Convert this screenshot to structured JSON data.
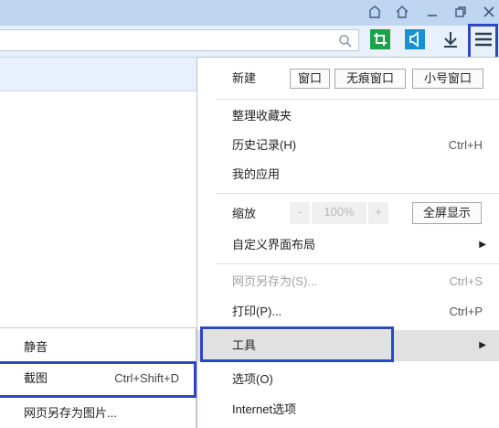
{
  "window": {
    "title_icons": [
      "skin-icon",
      "home-icon",
      "minimize-icon",
      "restore-icon",
      "close-icon"
    ]
  },
  "toolbar": {
    "address_value": "",
    "tools": [
      "search-icon",
      "crop-icon",
      "sound-icon",
      "download-icon",
      "menu-icon"
    ],
    "colors": {
      "crop": "#1aa34a",
      "sound": "#1691d2",
      "highlight": "#2b47c7"
    }
  },
  "menu": {
    "new": {
      "label": "新建",
      "buttons": [
        "窗口",
        "无痕窗口",
        "小号窗口"
      ]
    },
    "favorites": "整理收藏夹",
    "history": {
      "label": "历史记录(H)",
      "shortcut": "Ctrl+H"
    },
    "apps": "我的应用",
    "zoom": {
      "label": "缩放",
      "minus": "-",
      "level": "100%",
      "plus": "+",
      "fullscreen": "全屏显示"
    },
    "customize": "自定义界面布局",
    "save_as": {
      "label": "网页另存为(S)...",
      "shortcut": "Ctrl+S"
    },
    "print": {
      "label": "打印(P)...",
      "shortcut": "Ctrl+P"
    },
    "tools": "工具",
    "options": "选项(O)",
    "internet_options": "Internet选项"
  },
  "submenu": {
    "mute": "静音",
    "screenshot": {
      "label": "截图",
      "shortcut": "Ctrl+Shift+D"
    },
    "save_as_image": "网页另存为图片..."
  },
  "arrow_glyph": "▶"
}
